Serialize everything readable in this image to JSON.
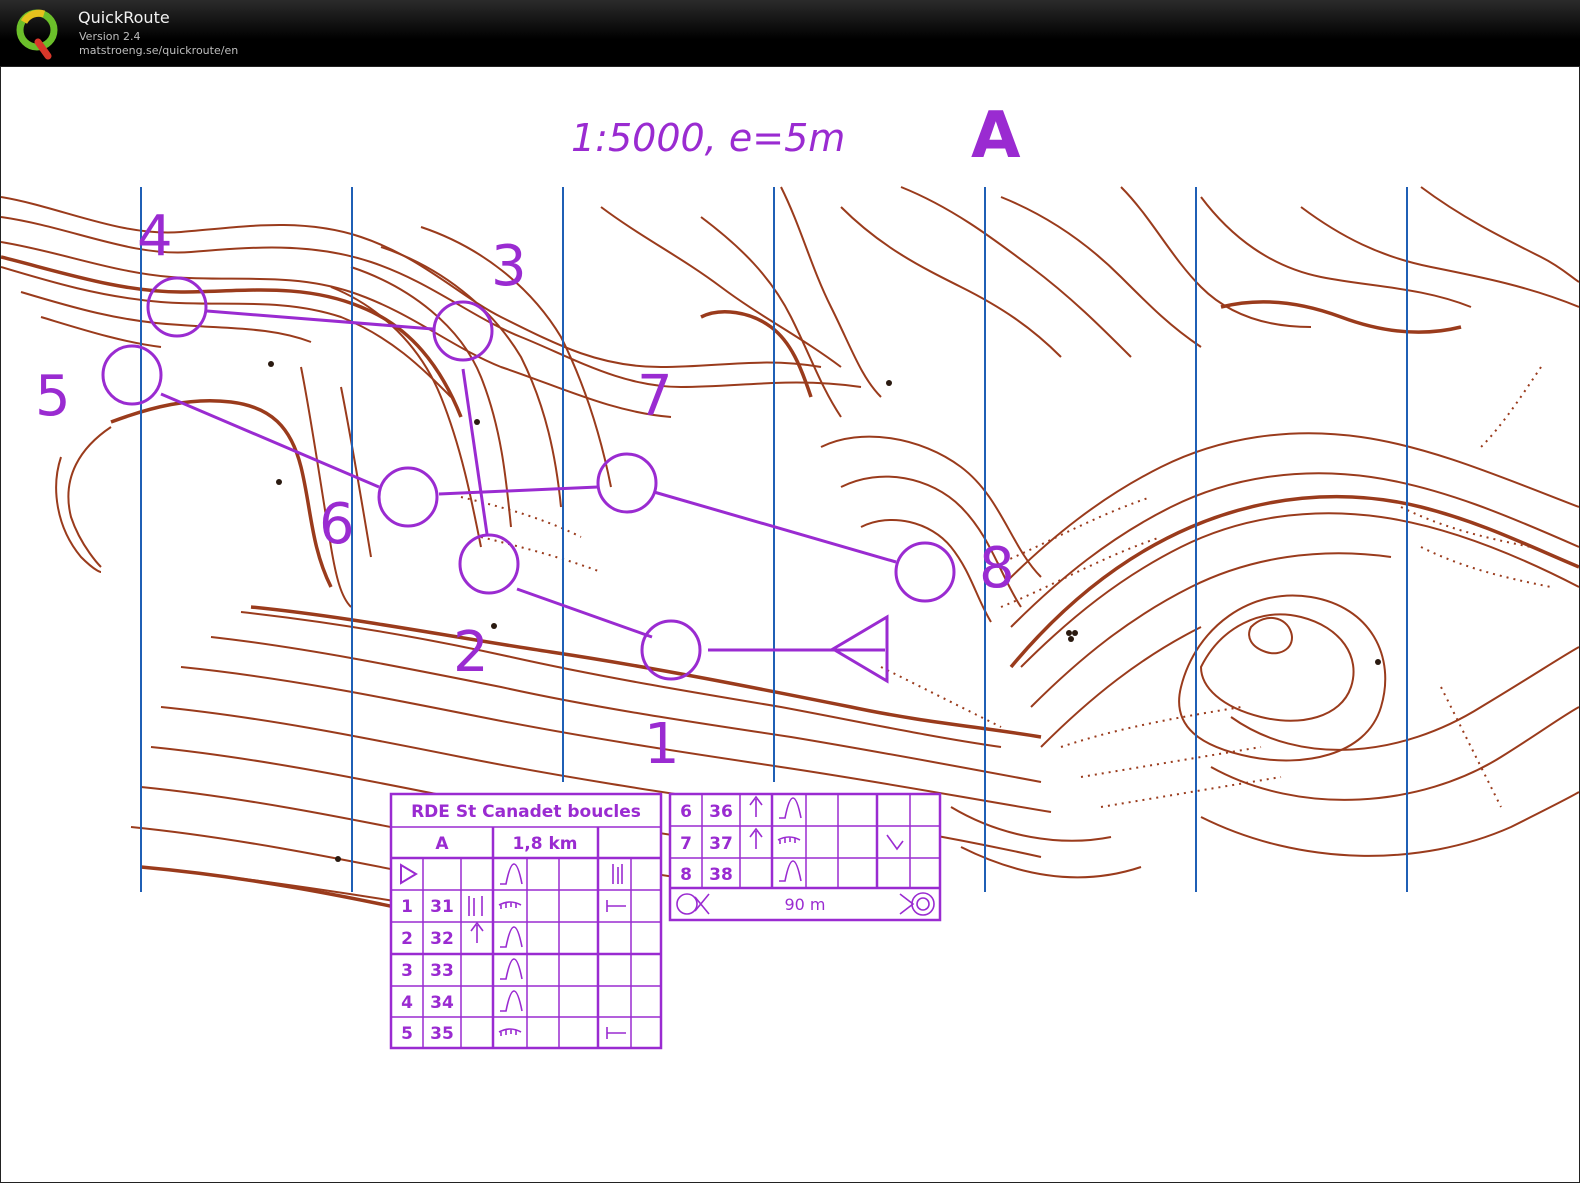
{
  "app": {
    "title": "QuickRoute",
    "version": "Version 2.4",
    "url": "matstroeng.se/quickroute/en"
  },
  "map": {
    "scale_label": "1:5000,  e=5m",
    "course_label": "A",
    "colors": {
      "contour": "#9a3b1c",
      "course": "#9a2bd1",
      "north_lines": "#1f5fb5"
    },
    "controls": [
      {
        "number": "1"
      },
      {
        "number": "2"
      },
      {
        "number": "3"
      },
      {
        "number": "4"
      },
      {
        "number": "5"
      },
      {
        "number": "6"
      },
      {
        "number": "7"
      },
      {
        "number": "8"
      }
    ]
  },
  "description_sheet": {
    "event": "RDE St Canadet boucles",
    "course": "A",
    "length": "1,8 km",
    "rows": [
      {
        "num": "1",
        "code": "31"
      },
      {
        "num": "2",
        "code": "32"
      },
      {
        "num": "3",
        "code": "33"
      },
      {
        "num": "4",
        "code": "34"
      },
      {
        "num": "5",
        "code": "35"
      },
      {
        "num": "6",
        "code": "36"
      },
      {
        "num": "7",
        "code": "37"
      },
      {
        "num": "8",
        "code": "38"
      }
    ],
    "finish_distance": "90 m"
  }
}
